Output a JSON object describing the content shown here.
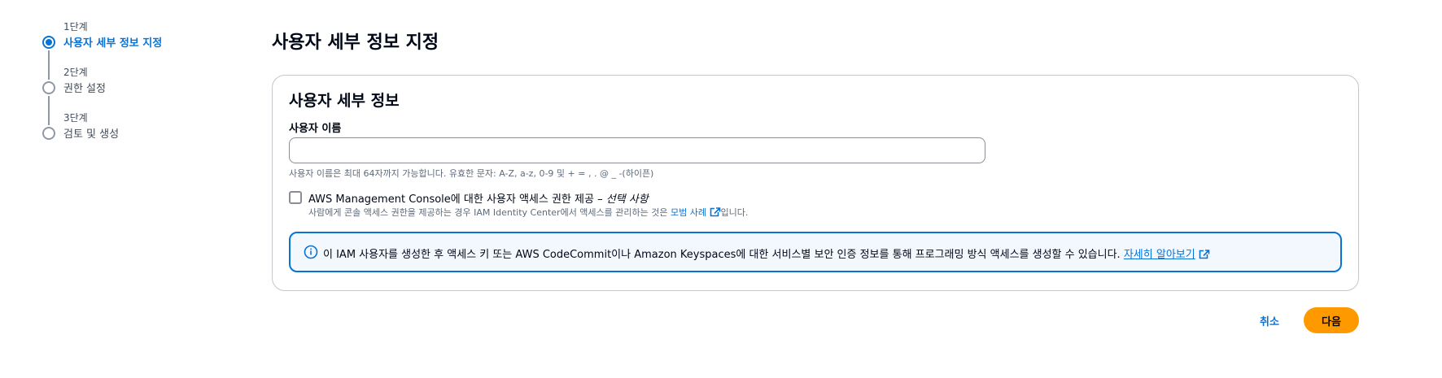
{
  "steps": [
    {
      "number": "1단계",
      "title": "사용자 세부 정보 지정",
      "active": true
    },
    {
      "number": "2단계",
      "title": "권한 설정",
      "active": false
    },
    {
      "number": "3단계",
      "title": "검토 및 생성",
      "active": false
    }
  ],
  "page": {
    "title": "사용자 세부 정보 지정"
  },
  "details": {
    "section_title": "사용자 세부 정보",
    "username_label": "사용자 이름",
    "username_value": "",
    "username_constraint": "사용자 이름은 최대 64자까지 가능합니다. 유효한 문자: A-Z, a-z, 0-9 및 + = , . @ _ -(하이픈)",
    "console_access": {
      "checked": false,
      "label": "AWS Management Console에 대한 사용자 액세스 권한 제공 –",
      "optional": "선택 사항",
      "description_before": "사람에게 콘솔 액세스 권한을 제공하는 경우 IAM Identity Center에서 액세스를 관리하는 것은",
      "description_link": "모범 사례",
      "description_after": "입니다."
    },
    "info": {
      "text": "이 IAM 사용자를 생성한 후 액세스 키 또는 AWS CodeCommit이나 Amazon Keyspaces에 대한 서비스별 보안 인증 정보를 통해 프로그래밍 방식 액세스를 생성할 수 있습니다.",
      "link": "자세히 알아보기"
    }
  },
  "footer": {
    "cancel_label": "취소",
    "next_label": "다음"
  },
  "colors": {
    "primary": "#0972d3",
    "accent_button": "#ff9900",
    "info_bg": "#f2f8fd"
  },
  "icons": {
    "info": "info-icon",
    "external": "external-link-icon"
  }
}
